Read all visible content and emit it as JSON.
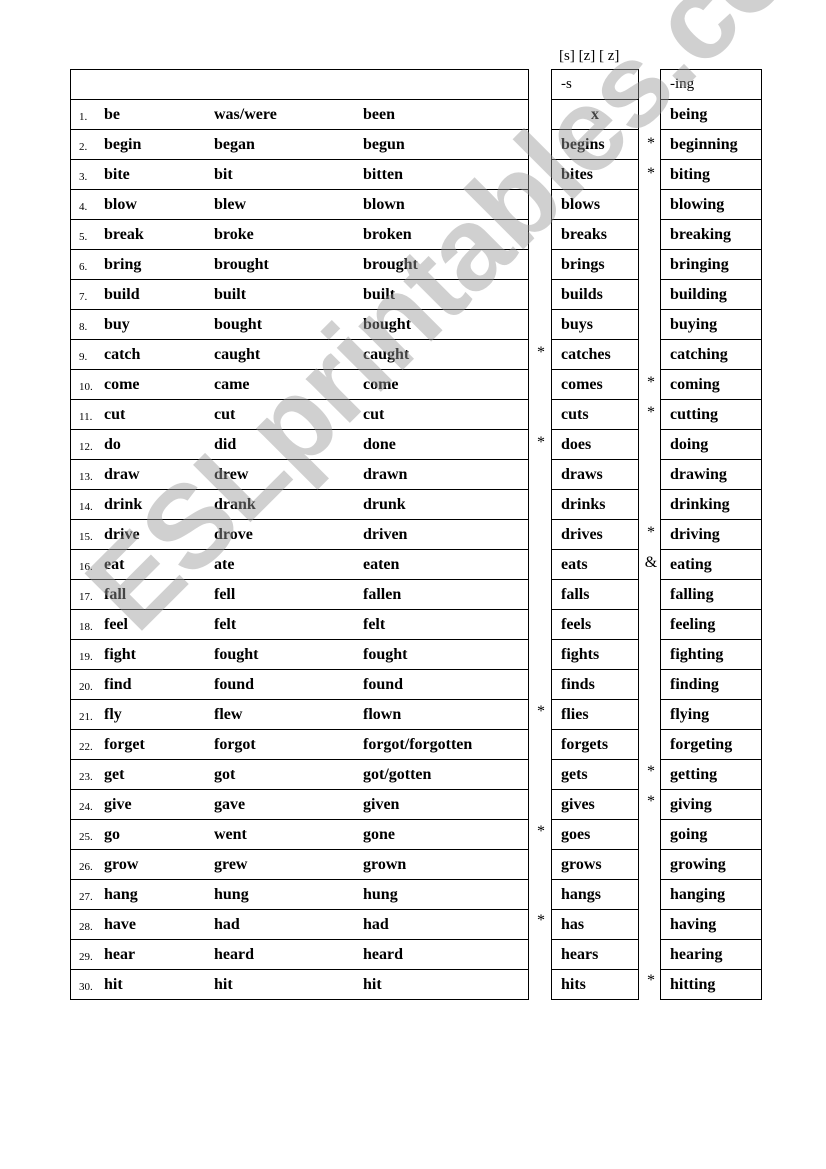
{
  "phonetic_header": "[s] [z] [ z]",
  "s_header": "-s",
  "ing_header": "-ing",
  "watermark": "ESLprintables.com",
  "verbs": [
    {
      "n": "1.",
      "base": "be",
      "past": "was/were",
      "pp": "been",
      "s": "x",
      "s_mark": "",
      "ing": "being",
      "ing_mark": ""
    },
    {
      "n": "2.",
      "base": "begin",
      "past": "began",
      "pp": "begun",
      "s": "begins",
      "s_mark": "",
      "ing": "beginning",
      "ing_mark": "*"
    },
    {
      "n": "3.",
      "base": "bite",
      "past": "bit",
      "pp": "bitten",
      "s": "bites",
      "s_mark": "",
      "ing": "biting",
      "ing_mark": "*"
    },
    {
      "n": "4.",
      "base": "blow",
      "past": "blew",
      "pp": "blown",
      "s": "blows",
      "s_mark": "",
      "ing": "blowing",
      "ing_mark": ""
    },
    {
      "n": "5.",
      "base": "break",
      "past": "broke",
      "pp": "broken",
      "s": "breaks",
      "s_mark": "",
      "ing": "breaking",
      "ing_mark": ""
    },
    {
      "n": "6.",
      "base": "bring",
      "past": "brought",
      "pp": "brought",
      "s": "brings",
      "s_mark": "",
      "ing": "bringing",
      "ing_mark": ""
    },
    {
      "n": "7.",
      "base": "build",
      "past": "built",
      "pp": "built",
      "s": "builds",
      "s_mark": "",
      "ing": "building",
      "ing_mark": ""
    },
    {
      "n": "8.",
      "base": "buy",
      "past": "bought",
      "pp": "bought",
      "s": "buys",
      "s_mark": "",
      "ing": "buying",
      "ing_mark": ""
    },
    {
      "n": "9.",
      "base": "catch",
      "past": "caught",
      "pp": "caught",
      "s": "catches",
      "s_mark": "*",
      "ing": "catching",
      "ing_mark": ""
    },
    {
      "n": "10.",
      "base": "come",
      "past": "came",
      "pp": "come",
      "s": "comes",
      "s_mark": "",
      "ing": "coming",
      "ing_mark": "*"
    },
    {
      "n": "11.",
      "base": "cut",
      "past": "cut",
      "pp": "cut",
      "s": "cuts",
      "s_mark": "",
      "ing": "cutting",
      "ing_mark": "*"
    },
    {
      "n": "12.",
      "base": "do",
      "past": "did",
      "pp": "done",
      "s": "does",
      "s_mark": "*",
      "ing": "doing",
      "ing_mark": ""
    },
    {
      "n": "13.",
      "base": "draw",
      "past": "drew",
      "pp": "drawn",
      "s": "draws",
      "s_mark": "",
      "ing": "drawing",
      "ing_mark": ""
    },
    {
      "n": "14.",
      "base": "drink",
      "past": "drank",
      "pp": "drunk",
      "s": "drinks",
      "s_mark": "",
      "ing": "drinking",
      "ing_mark": ""
    },
    {
      "n": "15.",
      "base": "drive",
      "past": "drove",
      "pp": "driven",
      "s": "drives",
      "s_mark": "",
      "ing": "driving",
      "ing_mark": "*"
    },
    {
      "n": "16.",
      "base": "eat",
      "past": "ate",
      "pp": "eaten",
      "s": "eats",
      "s_mark": "",
      "ing": "eating",
      "ing_mark": "&"
    },
    {
      "n": "17.",
      "base": "fall",
      "past": "fell",
      "pp": "fallen",
      "s": "falls",
      "s_mark": "",
      "ing": "falling",
      "ing_mark": ""
    },
    {
      "n": "18.",
      "base": "feel",
      "past": "felt",
      "pp": "felt",
      "s": "feels",
      "s_mark": "",
      "ing": "feeling",
      "ing_mark": ""
    },
    {
      "n": "19.",
      "base": "fight",
      "past": "fought",
      "pp": "fought",
      "s": "fights",
      "s_mark": "",
      "ing": "fighting",
      "ing_mark": ""
    },
    {
      "n": "20.",
      "base": "find",
      "past": "found",
      "pp": "found",
      "s": "finds",
      "s_mark": "",
      "ing": "finding",
      "ing_mark": ""
    },
    {
      "n": "21.",
      "base": "fly",
      "past": "flew",
      "pp": "flown",
      "s": "flies",
      "s_mark": "*",
      "ing": "flying",
      "ing_mark": ""
    },
    {
      "n": "22.",
      "base": "forget",
      "past": "forgot",
      "pp": "forgot/forgotten",
      "s": "forgets",
      "s_mark": "",
      "ing": "forgeting",
      "ing_mark": ""
    },
    {
      "n": "23.",
      "base": "get",
      "past": "got",
      "pp": "got/gotten",
      "s": "gets",
      "s_mark": "",
      "ing": "getting",
      "ing_mark": "*"
    },
    {
      "n": "24.",
      "base": "give",
      "past": "gave",
      "pp": "given",
      "s": "gives",
      "s_mark": "",
      "ing": "giving",
      "ing_mark": "*"
    },
    {
      "n": "25.",
      "base": "go",
      "past": "went",
      "pp": "gone",
      "s": "goes",
      "s_mark": "*",
      "ing": "going",
      "ing_mark": ""
    },
    {
      "n": "26.",
      "base": "grow",
      "past": "grew",
      "pp": "grown",
      "s": "grows",
      "s_mark": "",
      "ing": "growing",
      "ing_mark": ""
    },
    {
      "n": "27.",
      "base": "hang",
      "past": "hung",
      "pp": "hung",
      "s": "hangs",
      "s_mark": "",
      "ing": "hanging",
      "ing_mark": ""
    },
    {
      "n": "28.",
      "base": "have",
      "past": "had",
      "pp": "had",
      "s": "has",
      "s_mark": "*",
      "ing": "having",
      "ing_mark": ""
    },
    {
      "n": "29.",
      "base": "hear",
      "past": "heard",
      "pp": "heard",
      "s": "hears",
      "s_mark": "",
      "ing": "hearing",
      "ing_mark": ""
    },
    {
      "n": "30.",
      "base": "hit",
      "past": "hit",
      "pp": "hit",
      "s": "hits",
      "s_mark": "",
      "ing": "hitting",
      "ing_mark": "*"
    }
  ]
}
